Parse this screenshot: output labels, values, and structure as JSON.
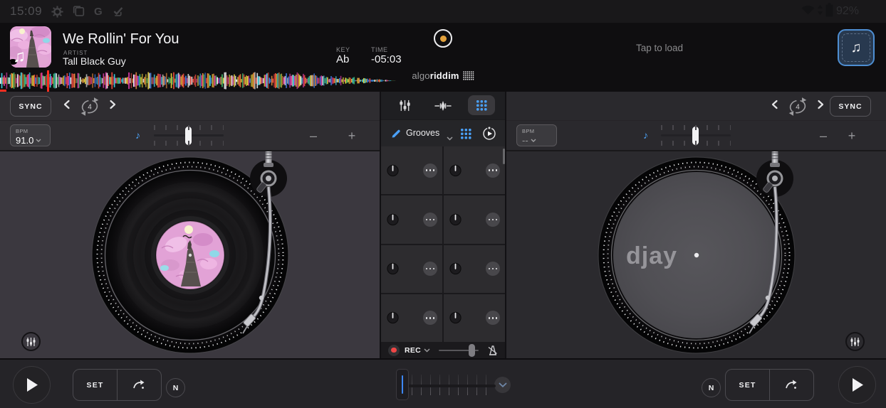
{
  "status_bar": {
    "time": "15:09",
    "battery_percent": "92%"
  },
  "header": {
    "track_title": "We Rollin' For You",
    "artist_label": "ARTIST",
    "artist_name": "Tall Black Guy",
    "key_label": "KEY",
    "key_value": "Ab",
    "time_label": "TIME",
    "time_value": "-05:03",
    "brand_algo": "algo",
    "brand_riddim": "riddim",
    "tap_to_load": "Tap to load"
  },
  "left_deck": {
    "sync_label": "SYNC",
    "loop_beats": "4",
    "bpm_label": "BPM",
    "bpm_value": "91.0",
    "minus": "–",
    "plus": "+"
  },
  "right_deck": {
    "sync_label": "SYNC",
    "loop_beats": "4",
    "bpm_label": "BPM",
    "bpm_value": "--",
    "minus": "–",
    "plus": "+",
    "platter_logo": "djay"
  },
  "center_panel": {
    "grooves_label": "Grooves",
    "rec_label": "REC",
    "pad_count": 8
  },
  "bottom_bar": {
    "set_label": "SET",
    "nudge_label": "N"
  },
  "icons": {
    "beamed_note": "♫",
    "eighth_note": "♪"
  },
  "colors": {
    "accent_blue": "#4aa0f8",
    "record_dot_orange": "#e2a13c",
    "rec_red": "#ef4646",
    "playhead_red": "#ff2d20",
    "waveform_palette": [
      "#e8483f",
      "#3fba6a",
      "#3f7fe8",
      "#e8d23f",
      "#3fd4e8",
      "#e83fb0",
      "#f0f0f0",
      "#e88a3f"
    ]
  }
}
